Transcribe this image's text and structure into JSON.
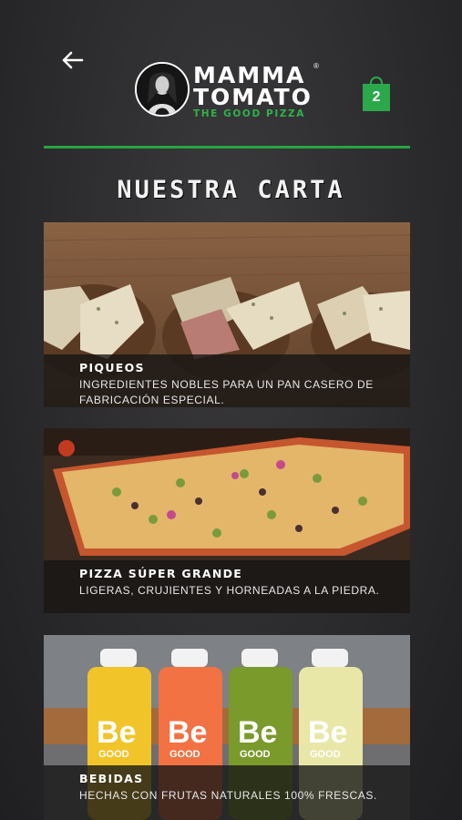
{
  "header": {
    "brand_line1": "MAMMA",
    "brand_line2": "TOMATO",
    "brand_reg": "®",
    "brand_tagline": "THE GOOD PIZZA",
    "cart_count": "2",
    "accent_color": "#2aa84a"
  },
  "page": {
    "title": "NUESTRA CARTA"
  },
  "menu": [
    {
      "title": "PIQUEOS",
      "description": "INGREDIENTES NOBLES PARA UN PAN CASERO DE FABRICACIÓN ESPECIAL."
    },
    {
      "title": "PIZZA SÚPER GRANDE",
      "description": "LIGERAS, CRUJIENTES Y HORNEADAS A LA PIEDRA."
    },
    {
      "title": "BEBIDAS",
      "description": "HECHAS CON FRUTAS NATURALES 100% FRESCAS.",
      "bottle_label": "Be",
      "bottle_sublabel": "GOOD"
    }
  ]
}
